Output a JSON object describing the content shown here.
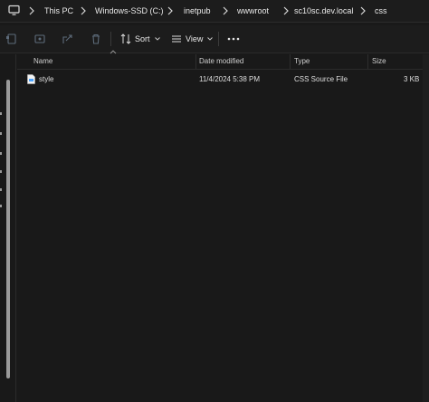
{
  "breadcrumb": {
    "items": [
      "This PC",
      "Windows-SSD (C:)",
      "inetpub",
      "wwwroot",
      "sc10sc.dev.local",
      "css"
    ]
  },
  "toolbar": {
    "sort_label": "Sort",
    "view_label": "View"
  },
  "table": {
    "columns": [
      "Name",
      "Date modified",
      "Type",
      "Size"
    ],
    "rows": [
      {
        "name": "style",
        "date": "11/4/2024 5:38 PM",
        "type": "CSS Source File",
        "size": "3 KB"
      }
    ]
  },
  "colors": {
    "background": "#191919",
    "text": "#e6e6e6",
    "accent": "#4aa3ff"
  },
  "icons": [
    "computer-icon",
    "chevron-right-icon",
    "copy-icon",
    "cut-icon",
    "share-icon",
    "delete-icon",
    "sort-icon",
    "view-icon",
    "more-icon",
    "file-css-icon"
  ]
}
